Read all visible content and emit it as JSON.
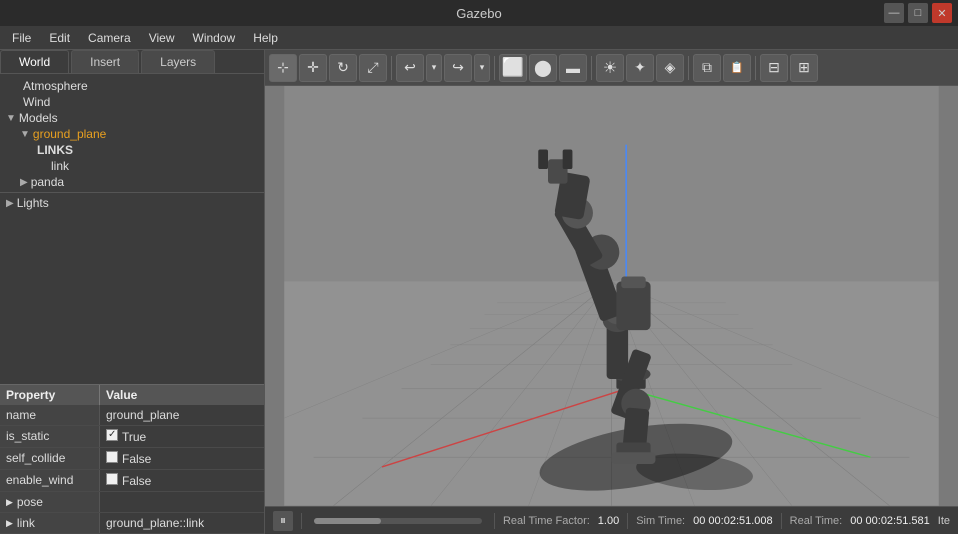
{
  "app": {
    "title": "Gazebo"
  },
  "titlebar": {
    "minimize": "—",
    "maximize": "□",
    "close": "✕"
  },
  "menubar": {
    "items": [
      "File",
      "Edit",
      "Camera",
      "View",
      "Window",
      "Help"
    ]
  },
  "tabs": {
    "world": "World",
    "insert": "Insert",
    "layers": "Layers"
  },
  "tree": {
    "items": [
      {
        "label": "Atmosphere",
        "indent": 1,
        "arrow": "",
        "highlighted": false
      },
      {
        "label": "Wind",
        "indent": 1,
        "arrow": "",
        "highlighted": false
      },
      {
        "label": "Models",
        "indent": 0,
        "arrow": "▼",
        "highlighted": false
      },
      {
        "label": "ground_plane",
        "indent": 1,
        "arrow": "▼",
        "highlighted": true
      },
      {
        "label": "LINKS",
        "indent": 2,
        "arrow": "",
        "highlighted": false
      },
      {
        "label": "link",
        "indent": 3,
        "arrow": "",
        "highlighted": false
      },
      {
        "label": "panda",
        "indent": 1,
        "arrow": "▶",
        "highlighted": false
      },
      {
        "label": "Lights",
        "indent": 0,
        "arrow": "▶",
        "highlighted": false
      }
    ]
  },
  "properties": {
    "header": {
      "col1": "Property",
      "col2": "Value"
    },
    "rows": [
      {
        "key": "name",
        "value": "ground_plane",
        "type": "text",
        "expandable": false
      },
      {
        "key": "is_static",
        "value": "True",
        "type": "checkbox_true",
        "expandable": false
      },
      {
        "key": "self_collide",
        "value": "False",
        "type": "checkbox_false",
        "expandable": false
      },
      {
        "key": "enable_wind",
        "value": "False",
        "type": "checkbox_false",
        "expandable": false
      },
      {
        "key": "pose",
        "value": "",
        "type": "text",
        "expandable": true
      },
      {
        "key": "link",
        "value": "ground_plane::link",
        "type": "text",
        "expandable": true
      }
    ]
  },
  "toolbar": {
    "buttons": [
      {
        "name": "select-tool",
        "icon": "⊹",
        "tooltip": "Select"
      },
      {
        "name": "translate-tool",
        "icon": "✛",
        "tooltip": "Translate"
      },
      {
        "name": "rotate-tool",
        "icon": "↻",
        "tooltip": "Rotate"
      },
      {
        "name": "scale-tool",
        "icon": "⤢",
        "tooltip": "Scale"
      },
      {
        "name": "undo",
        "icon": "↩",
        "tooltip": "Undo"
      },
      {
        "name": "undo-dropdown",
        "icon": "▾",
        "tooltip": ""
      },
      {
        "name": "redo",
        "icon": "↪",
        "tooltip": "Redo"
      },
      {
        "name": "redo-dropdown",
        "icon": "▾",
        "tooltip": ""
      },
      {
        "name": "box-shape",
        "icon": "⬜",
        "tooltip": "Box"
      },
      {
        "name": "sphere-shape",
        "icon": "⬤",
        "tooltip": "Sphere"
      },
      {
        "name": "cylinder-shape",
        "icon": "⬛",
        "tooltip": "Cylinder"
      },
      {
        "name": "light-point",
        "icon": "☀",
        "tooltip": "Point Light"
      },
      {
        "name": "light-dir",
        "icon": "✦",
        "tooltip": "Directional Light"
      },
      {
        "name": "light-spot",
        "icon": "◈",
        "tooltip": "Spot Light"
      },
      {
        "name": "copy",
        "icon": "⧉",
        "tooltip": "Copy"
      },
      {
        "name": "paste",
        "icon": "📋",
        "tooltip": "Paste"
      },
      {
        "name": "align",
        "icon": "⊟",
        "tooltip": "Align"
      },
      {
        "name": "snap",
        "icon": "⊞",
        "tooltip": "Snap"
      }
    ]
  },
  "statusbar": {
    "play_icon": "⏸",
    "rtf_label": "Real Time Factor:",
    "rtf_value": "1.00",
    "sim_label": "Sim Time:",
    "sim_value": "00 00:02:51.008",
    "real_label": "Real Time:",
    "real_value": "00 00:02:51.581",
    "ite_label": "Ite"
  }
}
